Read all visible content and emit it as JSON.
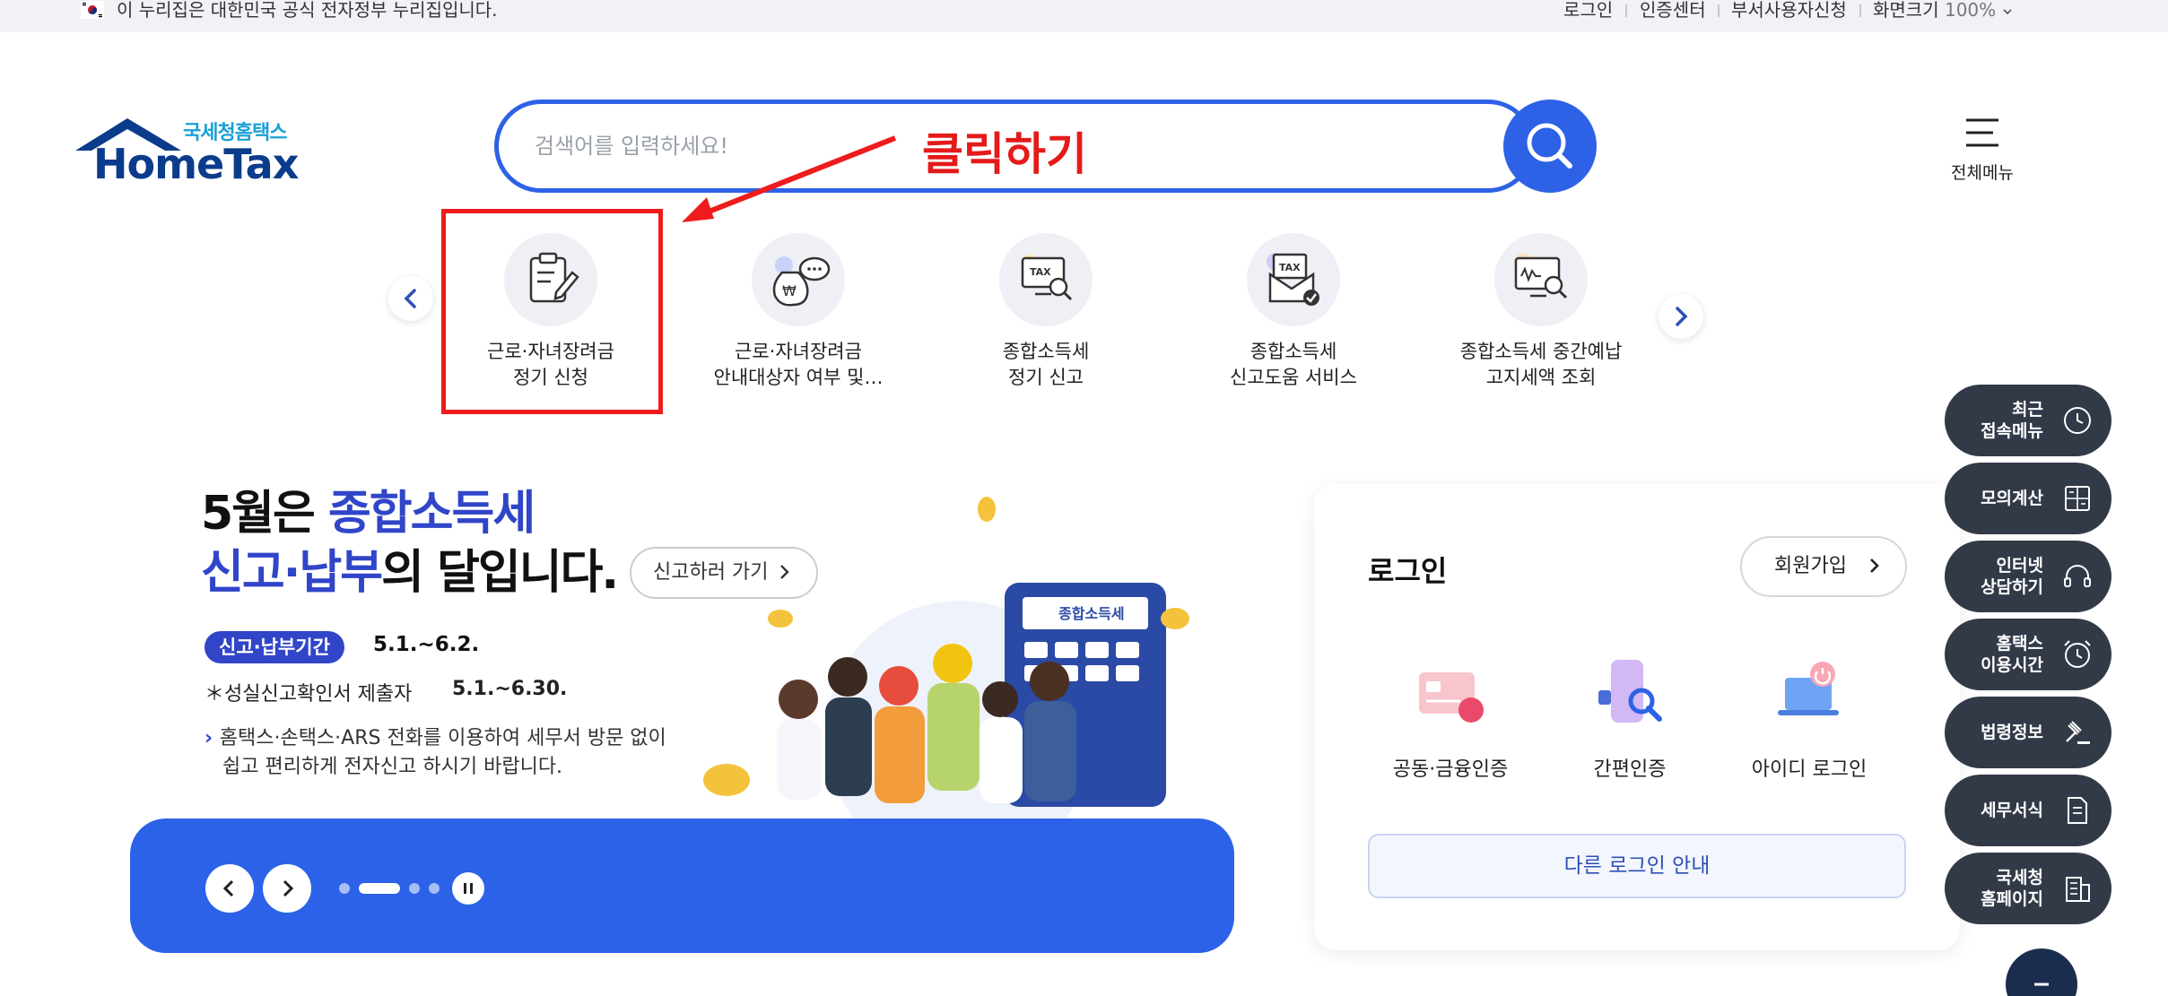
{
  "gov_bar": {
    "notice": "이 누리집은 대한민국 공식 전자정부 누리집입니다.",
    "links": [
      "로그인",
      "인증센터",
      "부서사용자신청"
    ],
    "zoom_label": "화면크기",
    "zoom_value": "100%"
  },
  "logo": {
    "sub": "국세청홈택스",
    "main": "HomeTax"
  },
  "search": {
    "placeholder": "검색어를 입력하세요!"
  },
  "full_menu": {
    "label": "전체메뉴"
  },
  "annotation": {
    "text": "클릭하기"
  },
  "quick_menu": [
    {
      "line1": "근로·자녀장려금",
      "line2": "정기 신청",
      "icon": "clipboard-pen-icon"
    },
    {
      "line1": "근로·자녀장려금",
      "line2": "안내대상자 여부 및…",
      "icon": "money-bag-chat-icon"
    },
    {
      "line1": "종합소득세",
      "line2": "정기 신고",
      "icon": "tax-monitor-search-icon"
    },
    {
      "line1": "종합소득세",
      "line2": "신고도움 서비스",
      "icon": "tax-envelope-check-icon"
    },
    {
      "line1": "종합소득세 중간예납",
      "line2": "고지세액 조회",
      "icon": "monitor-won-search-icon"
    }
  ],
  "banner": {
    "title_pre": "5월은 ",
    "title_highlight": "종합소득세",
    "title_line2_highlight": "신고·납부",
    "title_line2_post": "의 달입니다.",
    "go_label": "신고하러 가기",
    "period_badge": "신고·납부기간",
    "period_dates": "5.1.~6.2.",
    "note_label": "＊성실신고확인서 제출자",
    "note_dates": "5.1.~6.30.",
    "desc_line1": "홈택스·손택스·ARS 전화를 이용하여 세무서 방문 없이",
    "desc_line2": "쉽고 편리하게 전자신고 하시기 바랍니다.",
    "calculator_label": "종합소득세"
  },
  "login": {
    "title": "로그인",
    "join_label": "회원가입",
    "options": [
      "공동·금융인증",
      "간편인증",
      "아이디 로그인"
    ],
    "other_label": "다른 로그인 안내"
  },
  "side_menu": [
    {
      "line1": "최근",
      "line2": "접속메뉴",
      "icon": "clock-icon"
    },
    {
      "line1": "모의계산",
      "line2": "",
      "icon": "calculator-icon"
    },
    {
      "line1": "인터넷",
      "line2": "상담하기",
      "icon": "headset-icon"
    },
    {
      "line1": "홈택스",
      "line2": "이용시간",
      "icon": "alarm-clock-icon"
    },
    {
      "line1": "법령정보",
      "line2": "",
      "icon": "gavel-icon"
    },
    {
      "line1": "세무서식",
      "line2": "",
      "icon": "document-icon"
    },
    {
      "line1": "국세청",
      "line2": "홈페이지",
      "icon": "building-icon"
    }
  ],
  "colors": {
    "brand_blue": "#2d62e6",
    "annotation_red": "#ee1c1c",
    "side_dark": "#323a48"
  }
}
